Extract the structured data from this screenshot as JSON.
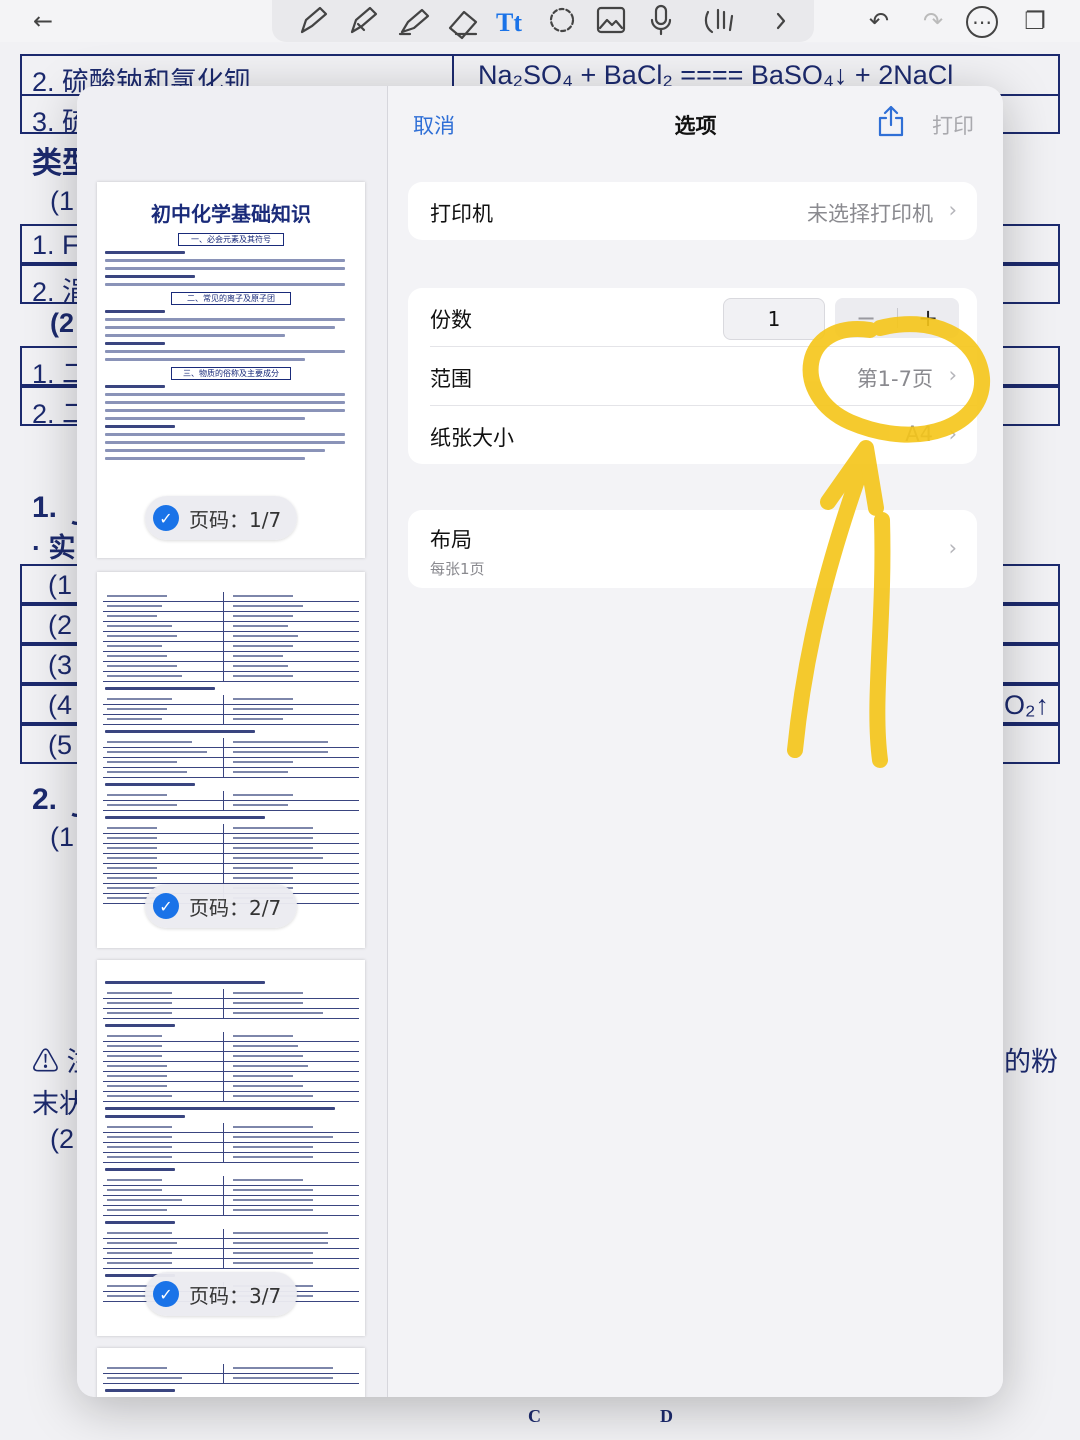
{
  "background": {
    "row1_left": "2. 硫酸钠和氯化钡",
    "row1_right": "Na₂SO₄ + BaCl₂ ==== BaSO₄↓ + 2NaCl",
    "row2_left": "3. 硫",
    "type_label": "类型",
    "right_fragment_1": "O₂↑",
    "right_fragment_2": "的粉",
    "left_fragments": [
      "(1",
      "1. F",
      "2. 涓",
      "(2",
      "1. 二",
      "2. 二",
      "1. ｊ",
      "· 实",
      "(1",
      "(2",
      "(3",
      "(4",
      "(5",
      "2. ｊ",
      "(1",
      "⚠ 注",
      "末状",
      "(2"
    ],
    "bottom_labels": [
      "C",
      "D"
    ]
  },
  "toolbar": {
    "back_icon": "←",
    "icons": [
      "pen-icon",
      "marker-icon",
      "highlighter-icon",
      "eraser-icon",
      "text-icon",
      "lasso-icon",
      "image-icon",
      "mic-icon",
      "hand-icon",
      "more-arrow-icon"
    ],
    "undo_icon": "↶",
    "redo_icon": "↷",
    "more_icon": "⋯",
    "pages_icon": "❐"
  },
  "dialog": {
    "cancel": "取消",
    "title": "选项",
    "print": "打印",
    "printer_label": "打印机",
    "printer_value": "未选择打印机",
    "copies_label": "份数",
    "copies_value": "1",
    "minus": "−",
    "plus": "+",
    "range_label": "范围",
    "range_value": "第1-7页",
    "paper_label": "纸张大小",
    "paper_value": "A4",
    "layout_label": "布局",
    "layout_sub": "每张1页",
    "chevron": "›"
  },
  "preview": {
    "doc_title": "初中化学基础知识",
    "section_1": "一、必会元素及其符号",
    "section_2": "二、常见的离子及原子团",
    "section_3": "三、物质的俗称及主要成分",
    "badges": [
      "页码：1/7",
      "页码：2/7",
      "页码：3/7"
    ],
    "check": "✓"
  },
  "colors": {
    "accent_blue": "#2f6fd6",
    "annotation_yellow": "#f5c518",
    "doc_navy": "#1c2a6e"
  }
}
